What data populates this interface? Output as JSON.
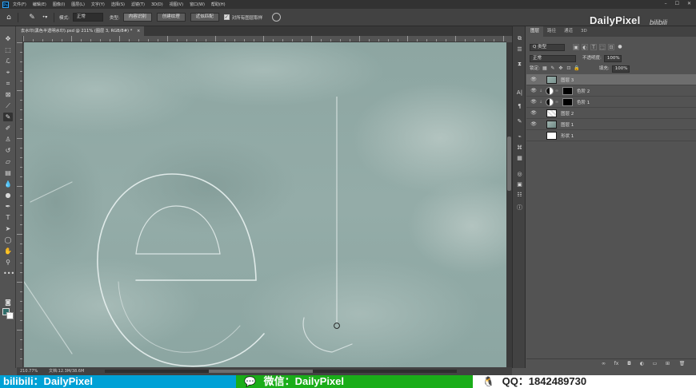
{
  "menubar": {
    "app_icon": "Ps",
    "items": [
      "文件(F)",
      "编辑(E)",
      "图像(I)",
      "图层(L)",
      "文字(Y)",
      "选择(S)",
      "滤镜(T)",
      "3D(D)",
      "视图(V)",
      "窗口(W)",
      "帮助(H)"
    ],
    "window_buttons": [
      "–",
      "☐",
      "✕"
    ]
  },
  "options": {
    "mode_label": "模式:",
    "mode_value": "正常",
    "type_label": "类型:",
    "type_buttons": [
      "内容识别",
      "创建纹理",
      "近似匹配"
    ],
    "sample_all_label": "对所有图层取样"
  },
  "watermark": {
    "brand": "DailyPixel",
    "site": "bilibili"
  },
  "document": {
    "tab_title": "去水印(黑色半透明水印).psd @ 211% (图层 3, RGB/8#) *",
    "tab_close": "×",
    "status_zoom": "210.77%",
    "status_doc": "文档:12.3M/38.6M"
  },
  "panel_strip_icons": [
    "history-icon",
    "properties-icon",
    "character-icon",
    "paragraph-icon",
    "tool-presets-icon",
    "brush-icon",
    "clone-source-icon",
    "swatches-icon",
    "navigator-icon",
    "adjustments-icon",
    "info-icon"
  ],
  "layers": {
    "tabs": [
      "图层",
      "路径",
      "通道",
      "3D"
    ],
    "filter_label": "Q 类型",
    "blend_mode": "正常",
    "opacity_label": "不透明度:",
    "opacity_value": "100%",
    "lock_label": "锁定:",
    "fill_label": "填充:",
    "fill_value": "100%",
    "items": [
      {
        "name": "图层 3",
        "kind": "pixel",
        "selected": true,
        "visible": true
      },
      {
        "name": "色阶 2",
        "kind": "adjustment",
        "selected": false,
        "visible": true
      },
      {
        "name": "色阶 1",
        "kind": "adjustment",
        "selected": false,
        "visible": true
      },
      {
        "name": "图层 2",
        "kind": "pixel",
        "selected": false,
        "visible": true
      },
      {
        "name": "图层 1",
        "kind": "pixel",
        "selected": false,
        "visible": true
      },
      {
        "name": "形状 1",
        "kind": "shape",
        "selected": false,
        "visible": false
      }
    ],
    "footer_icons": [
      "link-icon",
      "fx-icon",
      "mask-icon",
      "adjustment-icon",
      "group-icon",
      "new-layer-icon",
      "delete-icon"
    ],
    "footer_labels": [
      "∞",
      "fx",
      "◘",
      "◐",
      "▭",
      "⊞",
      "🗑"
    ]
  },
  "colors": {
    "foreground": "#2e6b68",
    "background": "#ffffff",
    "canvas_sky": "#8fa8a4",
    "banner_bili": "#00a1d6",
    "banner_wechat": "#1aad19",
    "banner_qq": "#ffffff"
  },
  "banner": {
    "bili_text": "bilibili：DailyPixel",
    "wechat_text": "微信：DailyPixel",
    "qq_text": "QQ：1842489730"
  }
}
